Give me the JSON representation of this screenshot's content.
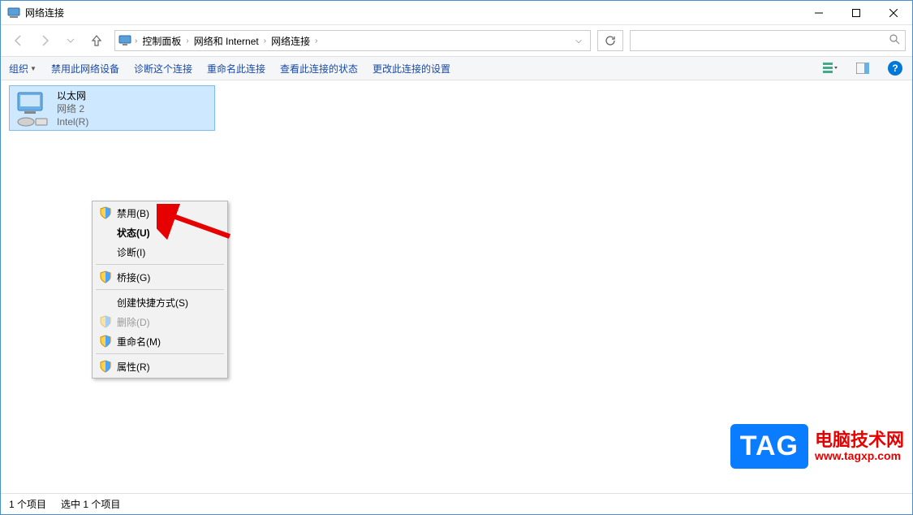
{
  "window": {
    "title": "网络连接"
  },
  "breadcrumb": {
    "seg1": "控制面板",
    "seg2": "网络和 Internet",
    "seg3": "网络连接"
  },
  "commandbar": {
    "organize": "组织",
    "disable": "禁用此网络设备",
    "diagnose": "诊断这个连接",
    "rename": "重命名此连接",
    "status": "查看此连接的状态",
    "settings": "更改此连接的设置"
  },
  "adapter": {
    "name": "以太网",
    "network": "网络 2",
    "device": "Intel(R)"
  },
  "contextmenu": {
    "disable": "禁用(B)",
    "status": "状态(U)",
    "diagnose": "诊断(I)",
    "bridge": "桥接(G)",
    "shortcut": "创建快捷方式(S)",
    "delete": "删除(D)",
    "rename": "重命名(M)",
    "properties": "属性(R)"
  },
  "statusbar": {
    "count": "1 个项目",
    "selected": "选中 1 个项目"
  },
  "watermark": {
    "tag": "TAG",
    "line1": "电脑技术网",
    "line2": "www.tagxp.com"
  }
}
